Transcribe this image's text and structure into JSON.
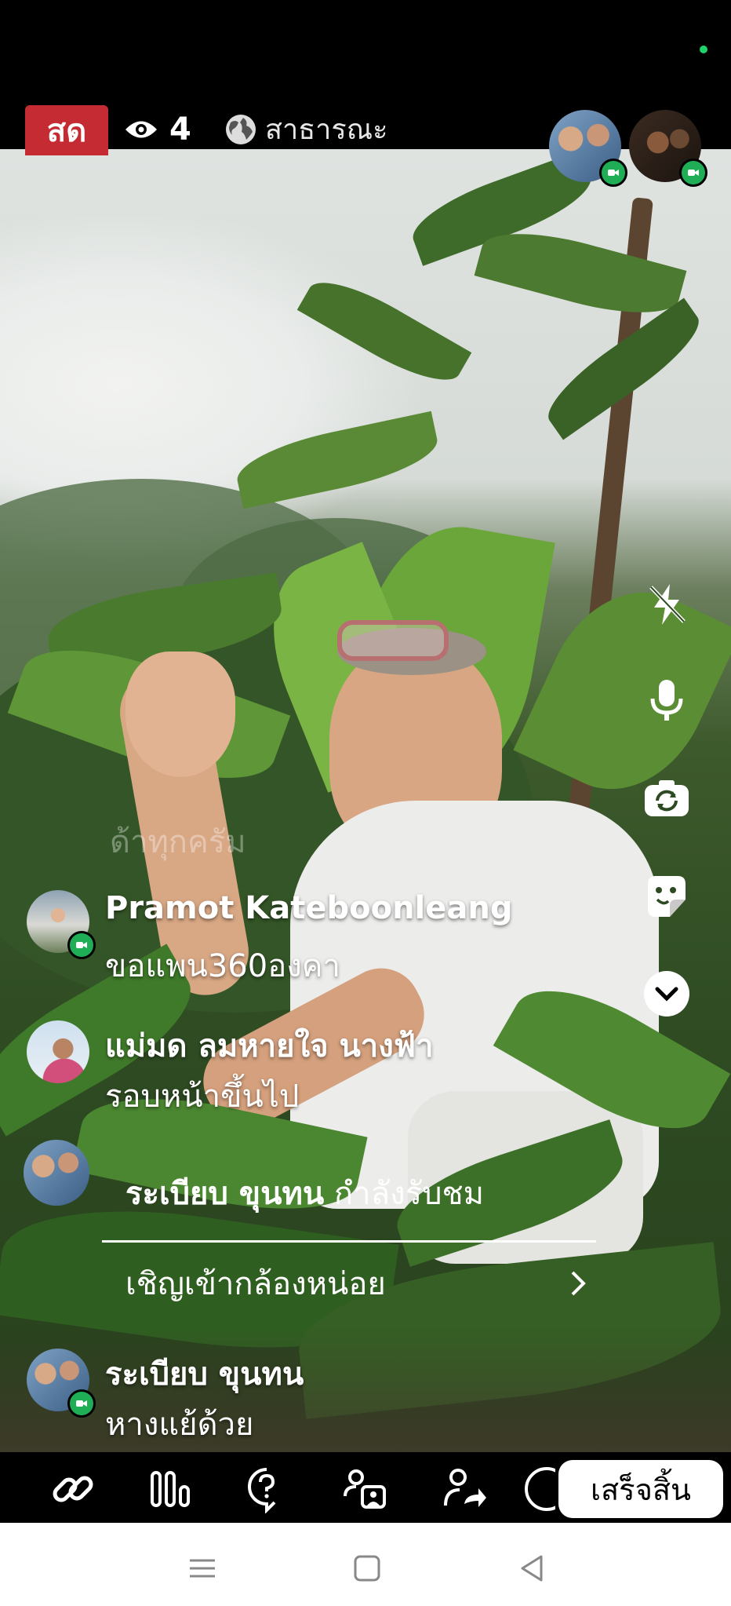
{
  "header": {
    "live_label": "สด",
    "viewer_count": "4",
    "audience_label": "สาธารณะ"
  },
  "overlay": {
    "faint_text": "ด้าทุกครัม"
  },
  "comments": [
    {
      "name": "Pramot Kateboonleang",
      "text": "ขอแพน360องคา"
    },
    {
      "name": "แม่มด ลมหายใจ นางฟ้า",
      "text": "รอบหน้าขึ้นไป"
    },
    {
      "name": "ระเบียบ ขุนทน",
      "text": "หางแย้ด้วย"
    }
  ],
  "invite": {
    "viewer_name": "ระเบียบ ขุนทน",
    "viewer_status": "กำลังรับชม",
    "action_label": "เชิญเข้ากล้องหน่อย"
  },
  "toolbar": {
    "finish_label": "เสร็จสิ้น"
  },
  "icons": {
    "top": [
      "eye-icon",
      "globe-icon"
    ],
    "right_controls": [
      "flash-off-icon",
      "microphone-icon",
      "camera-switch-icon",
      "sticker-icon",
      "chevron-down-icon"
    ],
    "bottom": [
      "link-icon",
      "poll-icon",
      "question-icon",
      "add-guest-icon",
      "share-person-icon"
    ],
    "nav": [
      "menu-icon",
      "home-icon",
      "back-icon"
    ]
  },
  "colors": {
    "live_red": "#c42b33",
    "camera_green": "#1fae56"
  }
}
